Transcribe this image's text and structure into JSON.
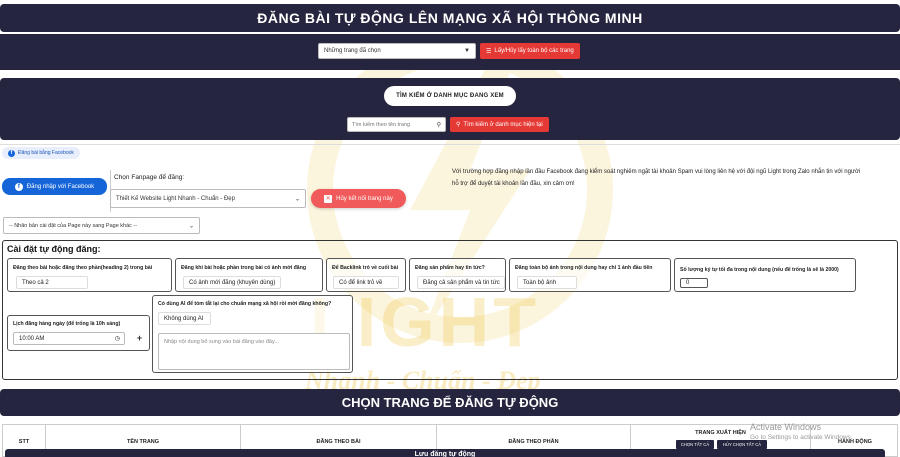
{
  "header": {
    "title": "ĐĂNG BÀI TỰ ĐỘNG LÊN MẠNG XÃ HỘI THÔNG MINH"
  },
  "page_select": {
    "value": "Những trang đã chọn",
    "toggle_label": "Lấy/Hủy lấy toàn bộ các trang"
  },
  "search": {
    "category_button": "TÌM KIẾM Ở DANH MỤC ĐANG XEM",
    "placeholder": "Tìm kiếm theo tên trang",
    "current_button": "Tìm kiếm ở danh mục hiện tại"
  },
  "facebook": {
    "tab_label": "Đăng bài bằng Facebook",
    "login_button": "Đăng nhập với Facebook",
    "fanpage_label": "Chọn Fanpage để đăng:",
    "fanpage_value": "Thiết Kế Website Light Nhanh - Chuẩn - Đẹp",
    "unlink_button": "Hủy kết nối trang này",
    "notice": "Với trường hợp đăng nhập lần đầu Facebook đang kiểm soát nghiêm ngặt tài khoản Spam vui lòng liên hệ với đội ngũ Light trong Zalo nhắn tin với người hỗ trợ để duyệt tài khoản lần đầu, xin cảm ơn!",
    "clone_select": "-- Nhân bản cài đặt của Page này sang Page khác --"
  },
  "settings": {
    "title": "Cài đặt tự động đăng:",
    "fields": {
      "post_type": {
        "label": "Đăng theo bài hoặc đăng theo phần(heading 2) trong bài",
        "value": "Theo cả 2"
      },
      "no_image": {
        "label": "Đăng khi bài hoặc phần trong bài có ảnh mới đăng",
        "value": "Có ảnh mới đăng (khuyên dùng)"
      },
      "backlink": {
        "label": "Để Backlink trỏ về cuối bài",
        "value": "Có để link trỏ về"
      },
      "product_news": {
        "label": "Đăng sản phẩm hay tin tức?",
        "value": "Đăng cả sản phẩm và tin tức"
      },
      "all_images": {
        "label": "Đăng toàn bộ ảnh trong nội dung hay chỉ 1 ảnh đầu tiên",
        "value": "Toàn bộ ảnh"
      },
      "max_chars": {
        "label": "Số lượng ký tự tối đa trong nội dung (nếu để trống là sẽ là 2000)",
        "value": "0"
      },
      "ai_summary": {
        "label": "Có dùng AI để tóm tắt lại cho chuẩn mạng xã hội rồi mới đăng không?",
        "value": "Không dùng AI"
      },
      "schedule": {
        "label": "Lịch đăng hàng ngày (để trống là 10h sáng)",
        "value": "10:00 AM"
      },
      "extra_content": {
        "placeholder": "Nhập nội dung bổ sung vào bài đăng vào đây..."
      }
    }
  },
  "page_section": {
    "title": "CHỌN TRANG ĐỂ ĐĂNG TỰ ĐỘNG",
    "columns": [
      "STT",
      "TÊN TRANG",
      "ĐĂNG THEO BÀI",
      "ĐĂNG THEO PHẦN",
      "TRANG XUẤT HIỆN",
      "HÀNH ĐỘNG"
    ],
    "select_all": "CHỌN TẤT CẢ",
    "deselect_all": "HỦY CHỌN TẤT CẢ"
  },
  "save_label": "Lưu đăng tự động",
  "watermark": {
    "brand": "LIGHT",
    "slogan": "Nhanh - Chuẩn - Đẹp"
  },
  "os_overlay": {
    "line1": "Activate Windows",
    "line2": "Go to Settings to activate Windows."
  },
  "colors": {
    "navy": "#25253f",
    "red": "#e53935",
    "facebook_blue": "#1565d8",
    "watermark_gold": "#e9b40c"
  }
}
